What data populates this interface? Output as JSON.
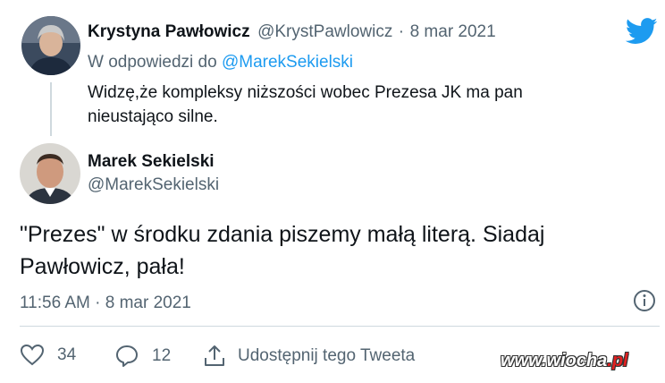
{
  "parent": {
    "name": "Krystyna Pawłowicz",
    "handle": "@KrystPawlowicz",
    "sep": "·",
    "date": "8 mar 2021",
    "reply_prefix": "W odpowiedzi do",
    "reply_handle": "@MarekSekielski",
    "text_line1": "Widzę,że kompleksy niższości wobec Prezesa JK ma pan",
    "text_line2": "nieustająco silne."
  },
  "main": {
    "name": "Marek Sekielski",
    "handle": "@MarekSekielski",
    "text_line1": "\"Prezes\" w środku zdania piszemy małą literą. Siadaj",
    "text_line2": "Pawłowicz, pała!",
    "timestamp": "11:56 AM · 8 mar 2021"
  },
  "actions": {
    "likes": "34",
    "replies": "12",
    "share_label": "Udostępnij tego Tweeta"
  },
  "watermark": {
    "text": "www.wiocha",
    "suffix": ".pl"
  },
  "icons": {
    "brand": "twitter-bird-icon",
    "info": "info-icon",
    "like": "heart-icon",
    "reply": "reply-icon",
    "share": "share-icon"
  },
  "colors": {
    "twitter_blue": "#1d9bf0",
    "secondary_text": "#536471",
    "primary_text": "#0f1419"
  }
}
